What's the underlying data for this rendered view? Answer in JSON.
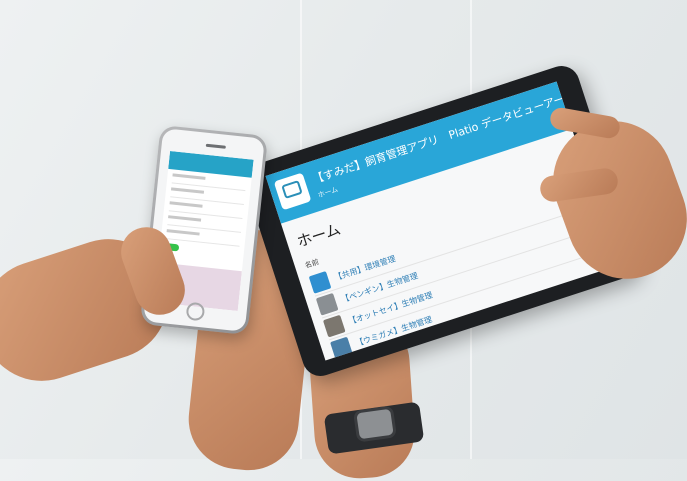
{
  "tablet_app": {
    "title": "【すみだ】飼育管理アプリ　Platio データビューアー",
    "breadcrumb": "ホーム",
    "page_heading": "ホーム",
    "column_label": "名前",
    "items": [
      {
        "label": "【共用】環境管理",
        "thumb_color": "#2f8fd0"
      },
      {
        "label": "【ペンギン】生物管理",
        "thumb_color": "#8a8f93"
      },
      {
        "label": "【オットセイ】生物管理",
        "thumb_color": "#7c776f"
      },
      {
        "label": "【ウミガメ】生物管理",
        "thumb_color": "#4a7fa8"
      }
    ]
  },
  "colors": {
    "header_blue": "#29a6d8",
    "phone_toggle_green": "#35c24a",
    "phone_pink_panel": "#e7d7e4"
  }
}
